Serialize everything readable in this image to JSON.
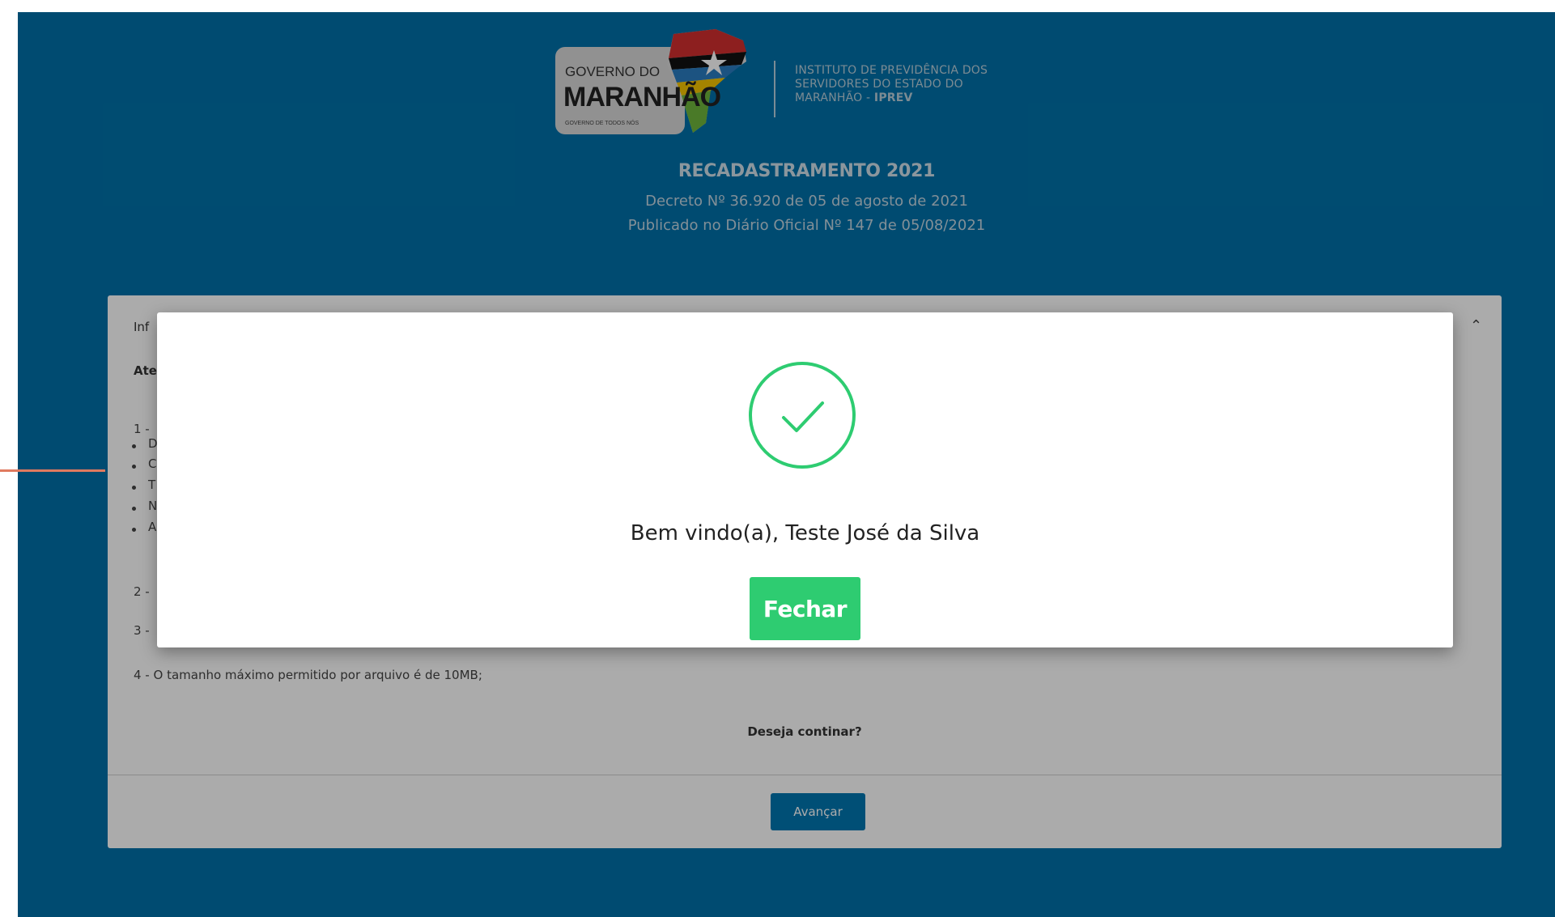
{
  "header": {
    "logo": {
      "line1": "GOVERNO DO",
      "line2": "MARANHÃO",
      "line3": "GOVERNO DE TODOS NÓS"
    },
    "institute_lines": [
      "INSTITUTO DE PREVIDÊNCIA DOS",
      "SERVIDORES DO ESTADO DO"
    ],
    "institute_prefix": "MARANHÃO - ",
    "institute_bold": "IPREV",
    "title": "RECADASTRAMENTO 2021",
    "decree": "Decreto Nº 36.920 de 05 de agosto de 2021",
    "published": "Publicado no Diário Oficial Nº 147 de 05/08/2021"
  },
  "card": {
    "heading": "Inf",
    "bold_line": "Ate",
    "item1_prefix": "1 -",
    "bullet_letters": [
      "D",
      "C",
      "T",
      "N",
      "A"
    ],
    "item2_prefix": "2 -",
    "item3_prefix": "3 -",
    "size_note": "4 - O tamanho máximo permitido por arquivo é de 10MB;",
    "question": "Deseja continar?",
    "advance_label": "Avançar"
  },
  "modal": {
    "welcome": "Bem vindo(a), Teste José da Silva",
    "close_label": "Fechar"
  },
  "colors": {
    "page_bg": "#0071a9",
    "success": "#2ecc71",
    "primary_button": "#0076b0",
    "annotation": "#e07a5f"
  },
  "icons": {
    "success": "check-circle-icon",
    "collapse": "chevron-up-icon"
  }
}
